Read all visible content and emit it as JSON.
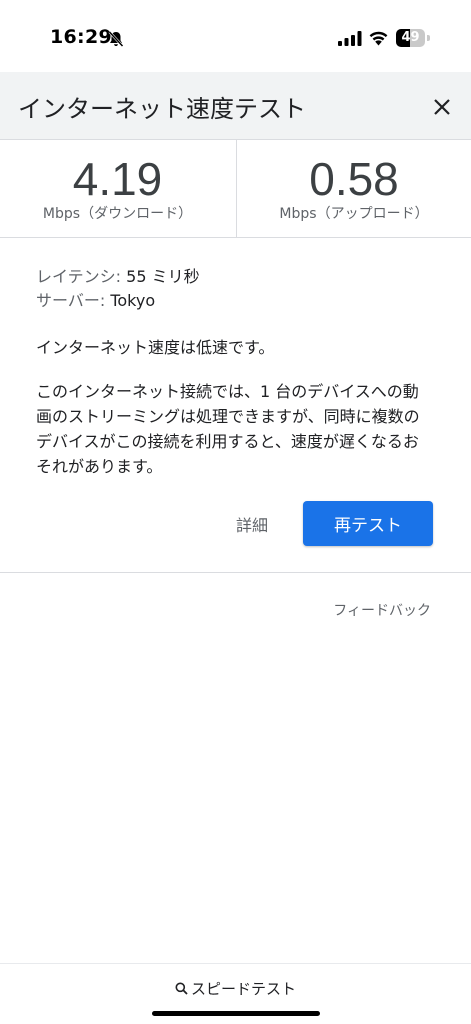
{
  "status_bar": {
    "time": "16:29",
    "battery_percent": "49",
    "battery_level": 0.49
  },
  "header": {
    "title": "インターネット速度テスト"
  },
  "results": {
    "download": {
      "value": "4.19",
      "unit": "Mbps（ダウンロード）"
    },
    "upload": {
      "value": "0.58",
      "unit": "Mbps（アップロード）"
    }
  },
  "details": {
    "latency_label": "レイテンシ:",
    "latency_value": "55 ミリ秒",
    "server_label": "サーバー:",
    "server_value": "Tokyo",
    "status_text": "インターネット速度は低速です。",
    "description": "このインターネット接続では、1 台のデバイスへの動画のストリーミングは処理できますが、同時に複数のデバイスがこの接続を利用すると、速度が遅くなるおそれがあります。"
  },
  "actions": {
    "details_label": "詳細",
    "retest_label": "再テスト",
    "feedback_label": "フィードバック"
  },
  "bottom_bar": {
    "query": "スピードテスト"
  },
  "colors": {
    "accent": "#1a73e8",
    "header_bg": "#f1f3f4"
  },
  "icons": [
    "bell-slash-icon",
    "cellular-signal-icon",
    "wifi-icon",
    "battery-icon",
    "close-icon",
    "search-icon"
  ]
}
